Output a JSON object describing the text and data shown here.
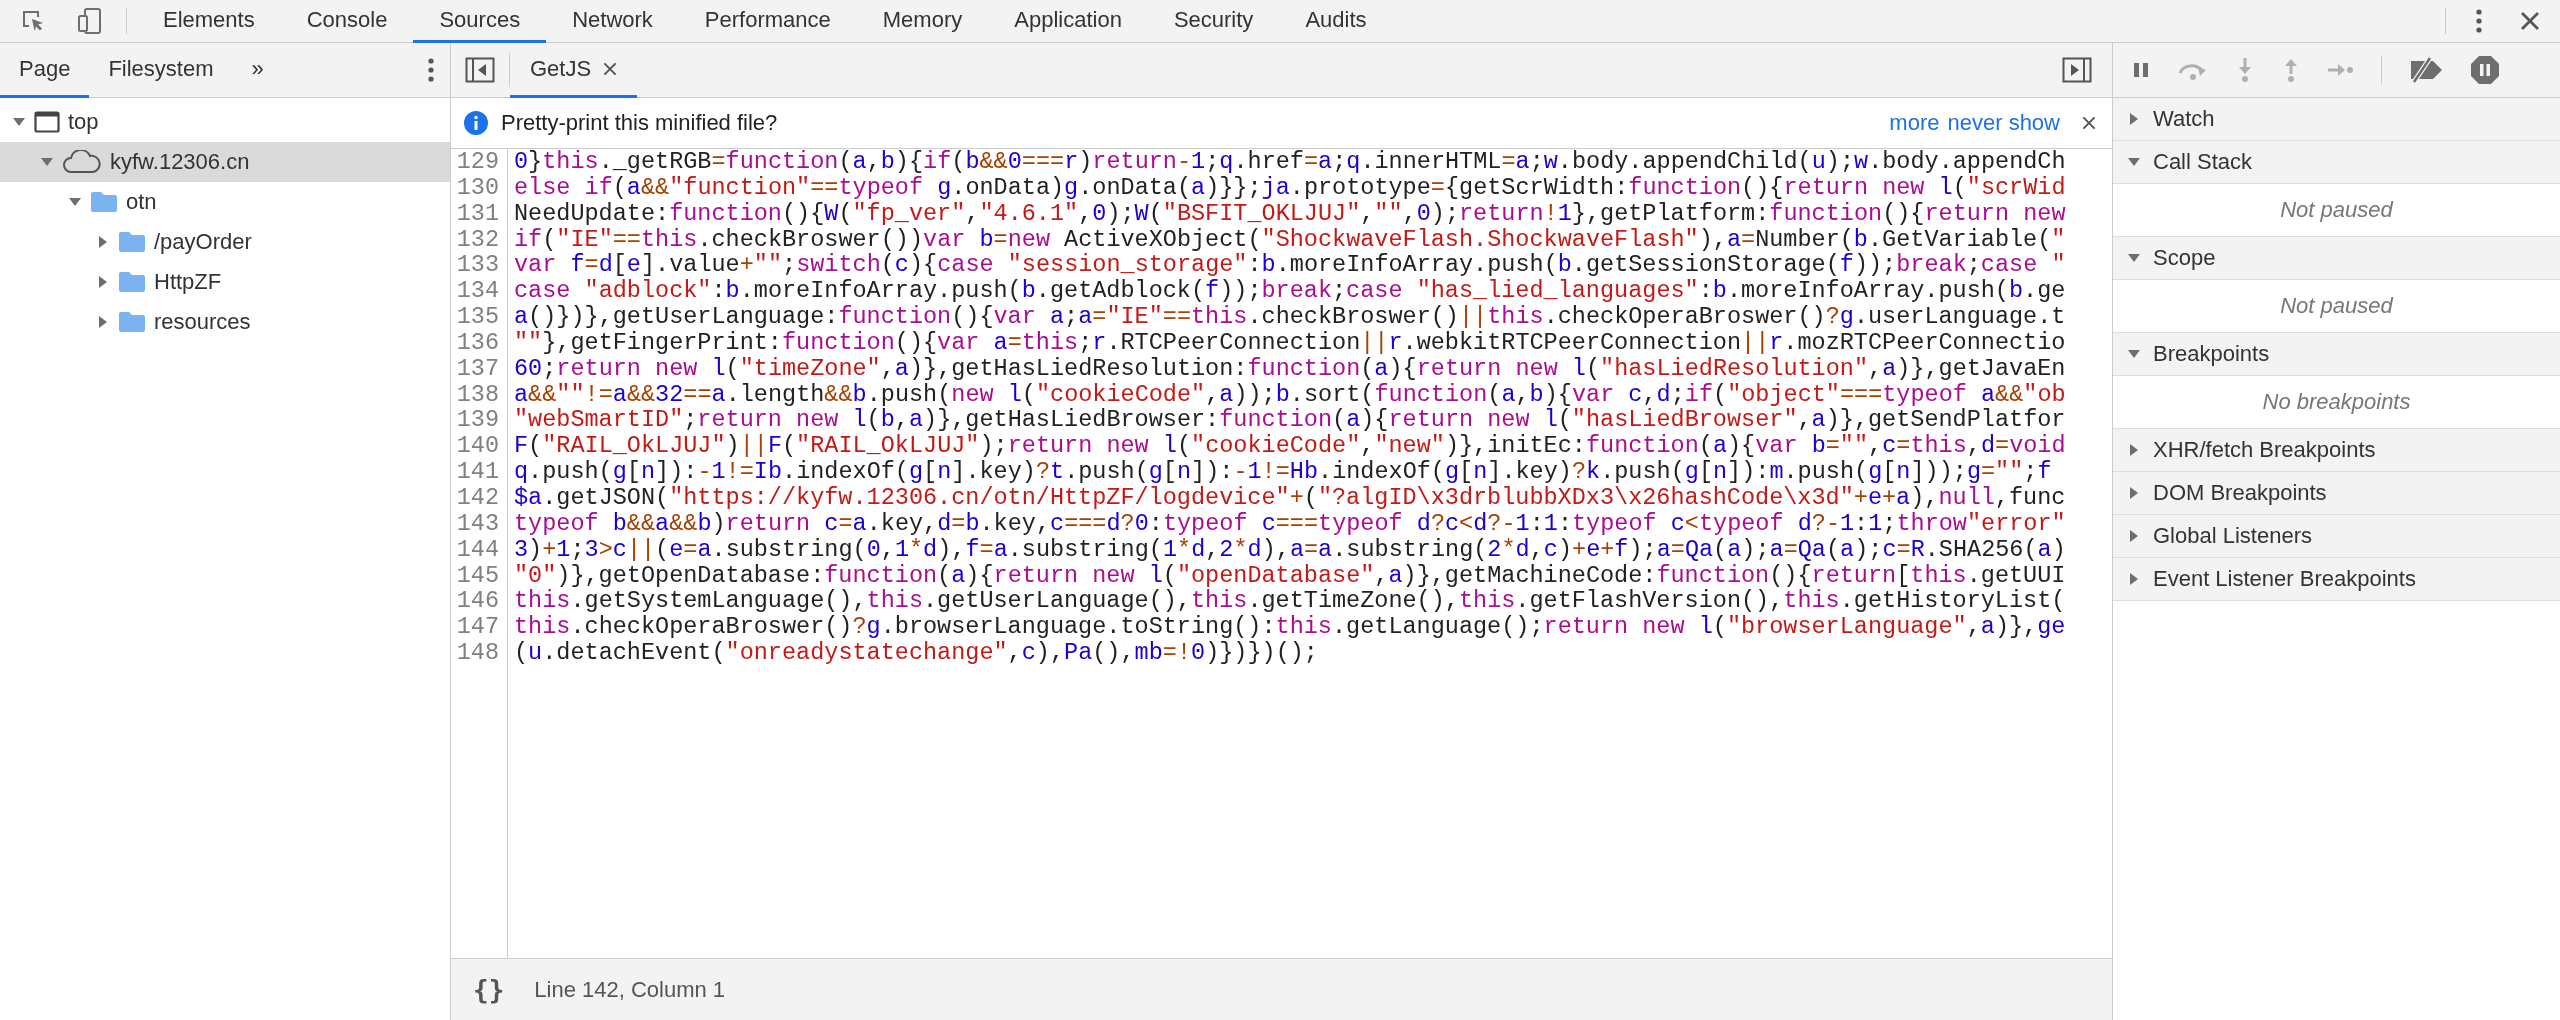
{
  "main_tabs": [
    {
      "label": "Elements",
      "selected": false
    },
    {
      "label": "Console",
      "selected": false
    },
    {
      "label": "Sources",
      "selected": true
    },
    {
      "label": "Network",
      "selected": false
    },
    {
      "label": "Performance",
      "selected": false
    },
    {
      "label": "Memory",
      "selected": false
    },
    {
      "label": "Application",
      "selected": false
    },
    {
      "label": "Security",
      "selected": false
    },
    {
      "label": "Audits",
      "selected": false
    }
  ],
  "navigator": {
    "tabs": [
      {
        "label": "Page",
        "selected": true
      },
      {
        "label": "Filesystem",
        "selected": false
      }
    ],
    "more": "»",
    "tree": [
      {
        "label": "top",
        "kind": "frame",
        "expanded": true,
        "selected": false,
        "children": [
          {
            "label": "kyfw.12306.cn",
            "kind": "domain",
            "expanded": true,
            "selected": true,
            "children": [
              {
                "label": "otn",
                "kind": "folder",
                "expanded": true,
                "selected": false,
                "children": [
                  {
                    "label": "/payOrder",
                    "kind": "folder",
                    "expanded": false,
                    "selected": false
                  },
                  {
                    "label": "HttpZF",
                    "kind": "folder",
                    "expanded": false,
                    "selected": false
                  },
                  {
                    "label": "resources",
                    "kind": "folder",
                    "expanded": false,
                    "selected": false
                  }
                ]
              }
            ]
          }
        ]
      }
    ]
  },
  "editor": {
    "tabs": [
      {
        "label": "GetJS",
        "selected": true
      }
    ],
    "infobar": {
      "message": "Pretty-print this minified file?",
      "links": [
        "more",
        "never show"
      ]
    },
    "lines": [
      {
        "number": "129",
        "code": "0}this._getRGB=function(a,b){if(b&&0===r)return-1;q.href=a;q.innerHTML=a;w.body.appendChild(u);w.body.appendCh"
      },
      {
        "number": "130",
        "code": "else if(a&&\"function\"==typeof g.onData)g.onData(a)}};ja.prototype={getScrWidth:function(){return new l(\"scrWid"
      },
      {
        "number": "131",
        "code": "NeedUpdate:function(){W(\"fp_ver\",\"4.6.1\",0);W(\"BSFIT_OKLJUJ\",\"\",0);return!1},getPlatform:function(){return new"
      },
      {
        "number": "132",
        "code": "if(\"IE\"==this.checkBroswer())var b=new ActiveXObject(\"ShockwaveFlash.ShockwaveFlash\"),a=Number(b.GetVariable(\""
      },
      {
        "number": "133",
        "code": "var f=d[e].value+\"\";switch(c){case \"session_storage\":b.moreInfoArray.push(b.getSessionStorage(f));break;case \""
      },
      {
        "number": "134",
        "code": "case \"adblock\":b.moreInfoArray.push(b.getAdblock(f));break;case \"has_lied_languages\":b.moreInfoArray.push(b.ge"
      },
      {
        "number": "135",
        "code": "a()})},getUserLanguage:function(){var a;a=\"IE\"==this.checkBroswer()||this.checkOperaBroswer()?g.userLanguage.t"
      },
      {
        "number": "136",
        "code": "\"\"},getFingerPrint:function(){var a=this;r.RTCPeerConnection||r.webkitRTCPeerConnection||r.mozRTCPeerConnectio"
      },
      {
        "number": "137",
        "code": "60;return new l(\"timeZone\",a)},getHasLiedResolution:function(a){return new l(\"hasLiedResolution\",a)},getJavaEn"
      },
      {
        "number": "138",
        "code": "a&&\"\"!=a&&32==a.length&&b.push(new l(\"cookieCode\",a));b.sort(function(a,b){var c,d;if(\"object\"===typeof a&&\"ob"
      },
      {
        "number": "139",
        "code": "\"webSmartID\";return new l(b,a)},getHasLiedBrowser:function(a){return new l(\"hasLiedBrowser\",a)},getSendPlatfor"
      },
      {
        "number": "140",
        "code": "F(\"RAIL_OkLJUJ\")||F(\"RAIL_OkLJUJ\");return new l(\"cookieCode\",\"new\")},initEc:function(a){var b=\"\",c=this,d=void"
      },
      {
        "number": "141",
        "code": "q.push(g[n]):-1!=Ib.indexOf(g[n].key)?t.push(g[n]):-1!=Hb.indexOf(g[n].key)?k.push(g[n]):m.push(g[n]));g=\"\";f"
      },
      {
        "number": "142",
        "code": "$a.getJSON(\"https://kyfw.12306.cn/otn/HttpZF/logdevice\"+(\"?algID\\x3drblubbXDx3\\x26hashCode\\x3d\"+e+a),null,func"
      },
      {
        "number": "143",
        "code": "typeof b&&a&&b)return c=a.key,d=b.key,c===d?0:typeof c===typeof d?c<d?-1:1:typeof c<typeof d?-1:1;throw\"error\""
      },
      {
        "number": "144",
        "code": "3)+1;3>c||(e=a.substring(0,1*d),f=a.substring(1*d,2*d),a=a.substring(2*d,c)+e+f);a=Qa(a);a=Qa(a);c=R.SHA256(a)"
      },
      {
        "number": "145",
        "code": "\"0\")},getOpenDatabase:function(a){return new l(\"openDatabase\",a)},getMachineCode:function(){return[this.getUUI"
      },
      {
        "number": "146",
        "code": "this.getSystemLanguage(),this.getUserLanguage(),this.getTimeZone(),this.getFlashVersion(),this.getHistoryList("
      },
      {
        "number": "147",
        "code": "this.checkOperaBroswer()?g.browserLanguage.toString():this.getLanguage();return new l(\"browserLanguage\",a)},ge"
      },
      {
        "number": "148",
        "code": "(u.detachEvent(\"onreadystatechange\",c),Pa(),mb=!0)})})();"
      }
    ],
    "pretty_print_button": "{}",
    "status": "Line 142, Column 1"
  },
  "debugger": {
    "sections": [
      {
        "title": "Watch",
        "expanded": false
      },
      {
        "title": "Call Stack",
        "expanded": true,
        "message": "Not paused"
      },
      {
        "title": "Scope",
        "expanded": true,
        "message": "Not paused"
      },
      {
        "title": "Breakpoints",
        "expanded": true,
        "message": "No breakpoints"
      },
      {
        "title": "XHR/fetch Breakpoints",
        "expanded": false
      },
      {
        "title": "DOM Breakpoints",
        "expanded": false
      },
      {
        "title": "Global Listeners",
        "expanded": false
      },
      {
        "title": "Event Listener Breakpoints",
        "expanded": false
      }
    ]
  }
}
